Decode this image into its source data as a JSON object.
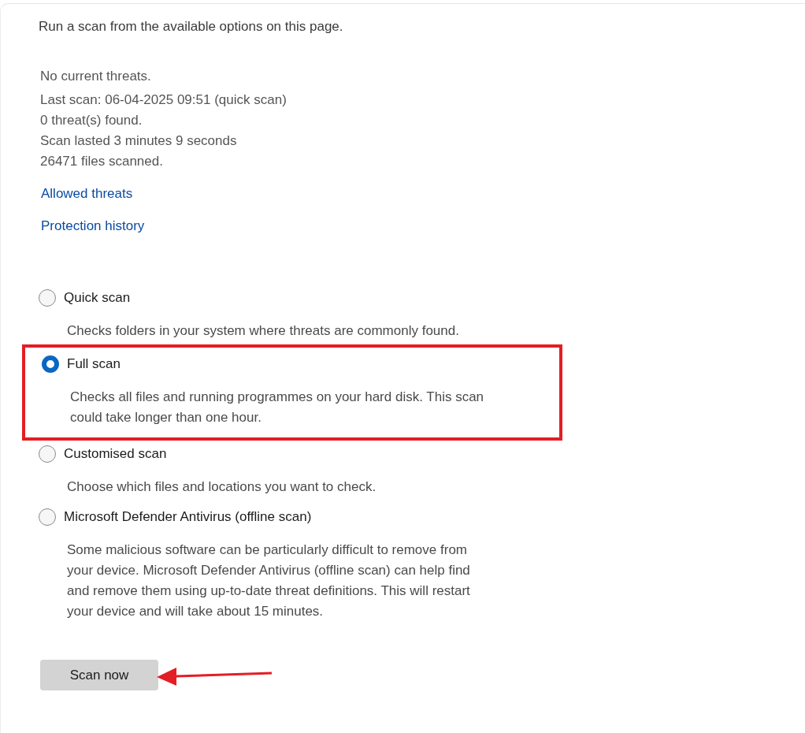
{
  "intro": "Run a scan from the available options on this page.",
  "status": [
    "No current threats.",
    "Last scan: 06-04-2025 09:51 (quick scan)",
    "0 threat(s) found.",
    "Scan lasted 3 minutes 9 seconds",
    "26471 files scanned."
  ],
  "links": [
    "Allowed threats",
    "Protection history"
  ],
  "scan_options": [
    {
      "label": "Quick scan",
      "description": "Checks folders in your system where threats are commonly found.",
      "selected": false,
      "highlighted": false
    },
    {
      "label": "Full scan",
      "description": "Checks all files and running programmes on your hard disk. This scan could take longer than one hour.",
      "selected": true,
      "highlighted": true
    },
    {
      "label": "Customised scan",
      "description": "Choose which files and locations you want to check.",
      "selected": false,
      "highlighted": false
    },
    {
      "label": "Microsoft Defender Antivirus (offline scan)",
      "description": "Some malicious software can be particularly difficult to remove from your device. Microsoft Defender Antivirus (offline scan) can help find and remove them using up-to-date threat definitions. This will restart your device and will take about 15 minutes.",
      "selected": false,
      "highlighted": false
    }
  ],
  "scan_button": {
    "label": "Scan now",
    "arrow_pointer": true
  }
}
